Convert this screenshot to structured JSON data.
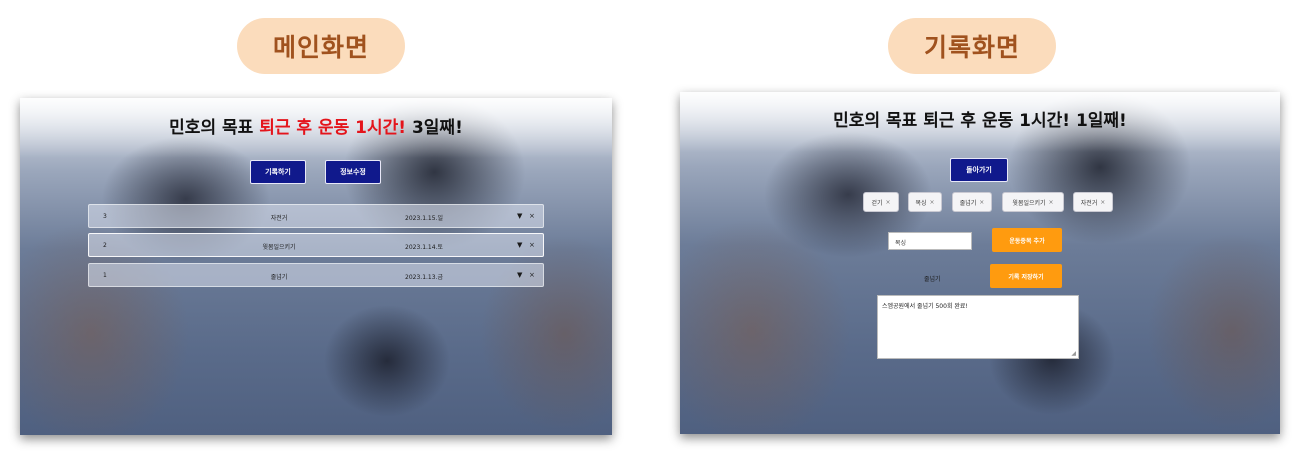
{
  "labels": {
    "main": "메인화면",
    "record": "기록화면"
  },
  "main_screen": {
    "title_prefix": "민호의 목표 ",
    "title_goal": "퇴근 후 운동 1시간!",
    "title_suffix": " 3일째!",
    "buttons": {
      "record": "기록하기",
      "edit": "정보수정"
    },
    "rows": [
      {
        "num": "3",
        "name": "자전거",
        "date": "2023.1.15.일",
        "caret": "▼",
        "close": "×"
      },
      {
        "num": "2",
        "name": "윗몸일으키기",
        "date": "2023.1.14.토",
        "caret": "▼",
        "close": "×"
      },
      {
        "num": "1",
        "name": "줄넘기",
        "date": "2023.1.13.금",
        "caret": "▼",
        "close": "×"
      }
    ]
  },
  "record_screen": {
    "title": "민호의 목표 퇴근 후 운동 1시간! 1일째!",
    "back_button": "돌아가기",
    "tags": [
      {
        "label": "걷기",
        "close": "×"
      },
      {
        "label": "복싱",
        "close": "×"
      },
      {
        "label": "줄넘기",
        "close": "×"
      },
      {
        "label": "윗몸일으키기",
        "close": "×"
      },
      {
        "label": "자전거",
        "close": "×"
      }
    ],
    "input_value": "복싱",
    "add_button": "운동종목 추가",
    "selected_item": "줄넘기",
    "save_button": "기록 저장하기",
    "memo": "스엠공원에서 줄넘기 500회 완료!",
    "resize_glyph": "◢"
  }
}
